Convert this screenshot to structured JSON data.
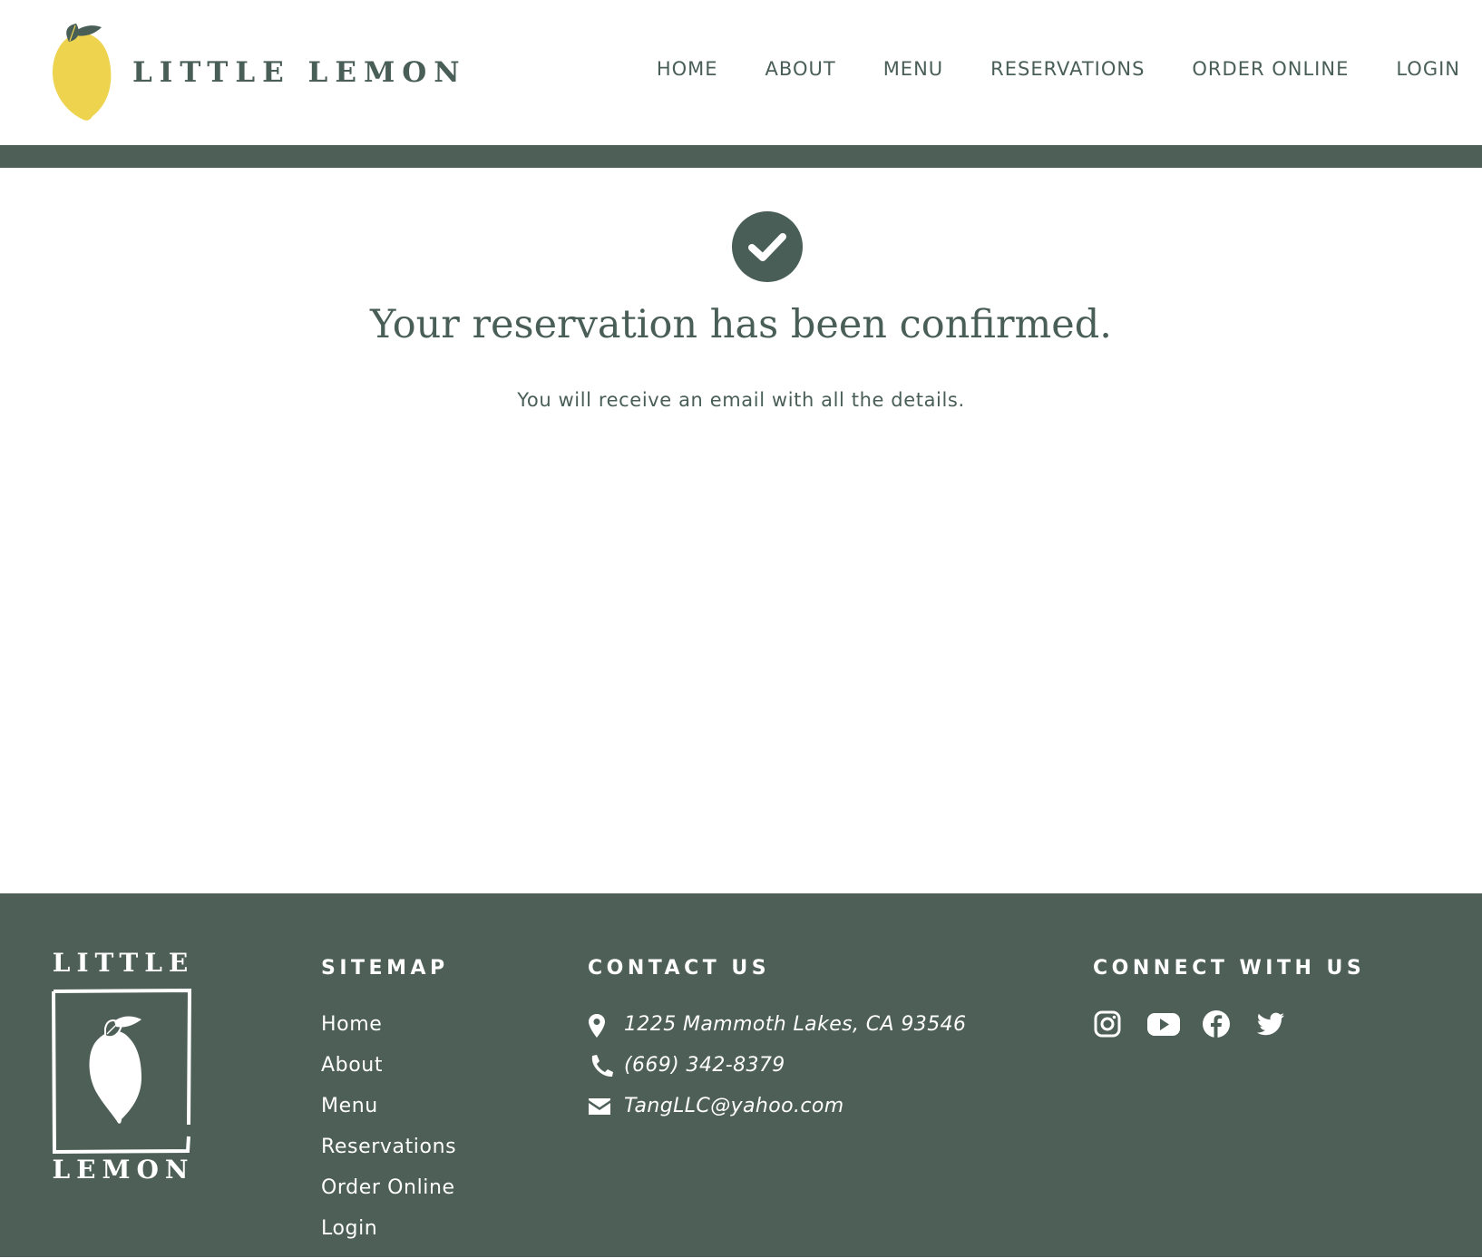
{
  "brand": {
    "name": "LITTLE LEMON",
    "logo_icon": "lemon-logo-icon"
  },
  "colors": {
    "primary": "#495e57",
    "band": "#4e5f58",
    "lemon": "#eed34f",
    "white": "#ffffff"
  },
  "nav": {
    "items": [
      "HOME",
      "ABOUT",
      "MENU",
      "RESERVATIONS",
      "ORDER ONLINE",
      "LOGIN"
    ]
  },
  "confirmation": {
    "icon": "check-circle-icon",
    "title": "Your reservation has been confirmed.",
    "subtitle": "You will receive an email with all the details."
  },
  "footer": {
    "logo_top": "LITTLE",
    "logo_bottom": "LEMON",
    "sitemap": {
      "title": "SITEMAP",
      "links": [
        "Home",
        "About",
        "Menu",
        "Reservations",
        "Order Online",
        "Login"
      ]
    },
    "contact": {
      "title": "CONTACT US",
      "address": "1225 Mammoth Lakes, CA 93546",
      "phone": "(669) 342-8379",
      "email": "TangLLC@yahoo.com",
      "icons": [
        "map-pin-icon",
        "phone-icon",
        "envelope-icon"
      ]
    },
    "connect": {
      "title": "CONNECT WITH US",
      "icons": [
        "instagram-icon",
        "youtube-icon",
        "facebook-icon",
        "twitter-icon"
      ]
    }
  }
}
